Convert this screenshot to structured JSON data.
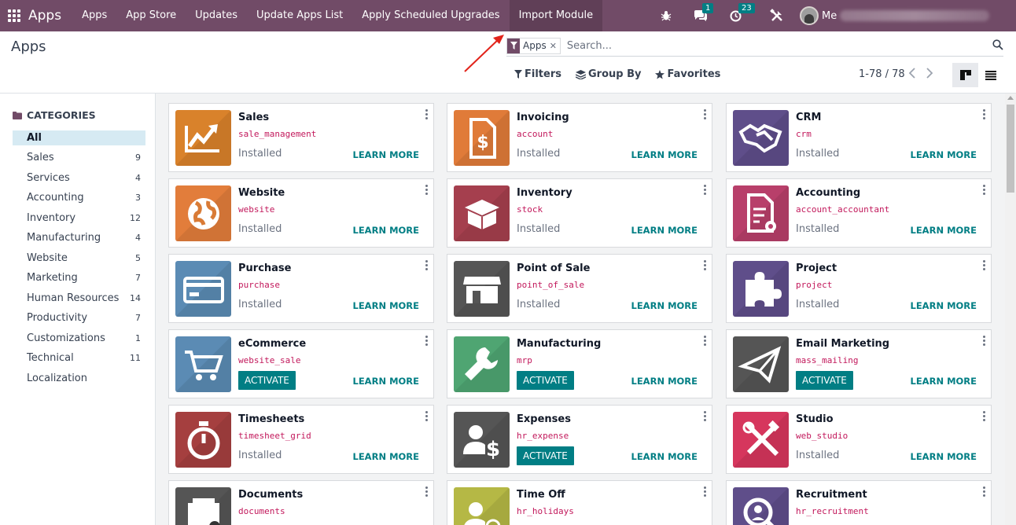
{
  "navbar": {
    "brand": "Apps",
    "menu": [
      "Apps",
      "App Store",
      "Updates",
      "Update Apps List",
      "Apply Scheduled Upgrades",
      "Import Module"
    ],
    "active_menu": "Import Module",
    "chat_badge": "1",
    "activity_badge": "23",
    "user_name": "Me",
    "accent": "#714b67"
  },
  "control_panel": {
    "title": "Apps",
    "search_facet": "Apps",
    "search_placeholder": "Search...",
    "filters_label": "Filters",
    "groupby_label": "Group By",
    "favorites_label": "Favorites",
    "pager": "1-78 / 78"
  },
  "sidebar": {
    "header": "CATEGORIES",
    "items": [
      {
        "label": "All",
        "count": "",
        "active": true
      },
      {
        "label": "Sales",
        "count": "9"
      },
      {
        "label": "Services",
        "count": "4"
      },
      {
        "label": "Accounting",
        "count": "3"
      },
      {
        "label": "Inventory",
        "count": "12"
      },
      {
        "label": "Manufacturing",
        "count": "4"
      },
      {
        "label": "Website",
        "count": "5"
      },
      {
        "label": "Marketing",
        "count": "7"
      },
      {
        "label": "Human Resources",
        "count": "14"
      },
      {
        "label": "Productivity",
        "count": "7"
      },
      {
        "label": "Customizations",
        "count": "1"
      },
      {
        "label": "Technical",
        "count": "11"
      },
      {
        "label": "Localization",
        "count": ""
      }
    ]
  },
  "cards": [
    {
      "name": "Sales",
      "tech": "sale_management",
      "status": "Installed",
      "activate": "",
      "learn": "LEARN MORE",
      "color": "#d9822b",
      "icon": "chart-icon"
    },
    {
      "name": "Invoicing",
      "tech": "account",
      "status": "Installed",
      "activate": "",
      "learn": "LEARN MORE",
      "color": "#e07b39",
      "icon": "invoice-icon"
    },
    {
      "name": "CRM",
      "tech": "crm",
      "status": "Installed",
      "activate": "",
      "learn": "LEARN MORE",
      "color": "#5f4e8a",
      "icon": "handshake-icon"
    },
    {
      "name": "Website",
      "tech": "website",
      "status": "Installed",
      "activate": "",
      "learn": "LEARN MORE",
      "color": "#e27d3b",
      "icon": "globe-icon"
    },
    {
      "name": "Inventory",
      "tech": "stock",
      "status": "Installed",
      "activate": "",
      "learn": "LEARN MORE",
      "color": "#a53f4e",
      "icon": "box-icon"
    },
    {
      "name": "Accounting",
      "tech": "account_accountant",
      "status": "Installed",
      "activate": "",
      "learn": "LEARN MORE",
      "color": "#b83f6a",
      "icon": "document-gear-icon"
    },
    {
      "name": "Purchase",
      "tech": "purchase",
      "status": "Installed",
      "activate": "",
      "learn": "LEARN MORE",
      "color": "#5b8bb4",
      "icon": "credit-card-icon"
    },
    {
      "name": "Point of Sale",
      "tech": "point_of_sale",
      "status": "Installed",
      "activate": "",
      "learn": "LEARN MORE",
      "color": "#555555",
      "icon": "store-icon"
    },
    {
      "name": "Project",
      "tech": "project",
      "status": "Installed",
      "activate": "",
      "learn": "LEARN MORE",
      "color": "#5f4e8a",
      "icon": "puzzle-icon"
    },
    {
      "name": "eCommerce",
      "tech": "website_sale",
      "status": "",
      "activate": "ACTIVATE",
      "learn": "LEARN MORE",
      "color": "#5b8bb4",
      "icon": "cart-icon"
    },
    {
      "name": "Manufacturing",
      "tech": "mrp",
      "status": "",
      "activate": "ACTIVATE",
      "learn": "LEARN MORE",
      "color": "#4fa572",
      "icon": "wrench-icon"
    },
    {
      "name": "Email Marketing",
      "tech": "mass_mailing",
      "status": "",
      "activate": "ACTIVATE",
      "learn": "LEARN MORE",
      "color": "#555555",
      "icon": "paper-plane-icon"
    },
    {
      "name": "Timesheets",
      "tech": "timesheet_grid",
      "status": "Installed",
      "activate": "",
      "learn": "LEARN MORE",
      "color": "#a53f3f",
      "icon": "stopwatch-icon"
    },
    {
      "name": "Expenses",
      "tech": "hr_expense",
      "status": "",
      "activate": "ACTIVATE",
      "learn": "LEARN MORE",
      "color": "#555555",
      "icon": "user-dollar-icon"
    },
    {
      "name": "Studio",
      "tech": "web_studio",
      "status": "Installed",
      "activate": "",
      "learn": "LEARN MORE",
      "color": "#d6365d",
      "icon": "tools-icon"
    },
    {
      "name": "Documents",
      "tech": "documents",
      "status": "",
      "activate": "",
      "learn": "",
      "color": "#555555",
      "icon": "folder-icon"
    },
    {
      "name": "Time Off",
      "tech": "hr_holidays",
      "status": "",
      "activate": "",
      "learn": "",
      "color": "#b5b845",
      "icon": "sun-user-icon"
    },
    {
      "name": "Recruitment",
      "tech": "hr_recruitment",
      "status": "",
      "activate": "",
      "learn": "",
      "color": "#5f4e8a",
      "icon": "magnifier-user-icon"
    }
  ]
}
